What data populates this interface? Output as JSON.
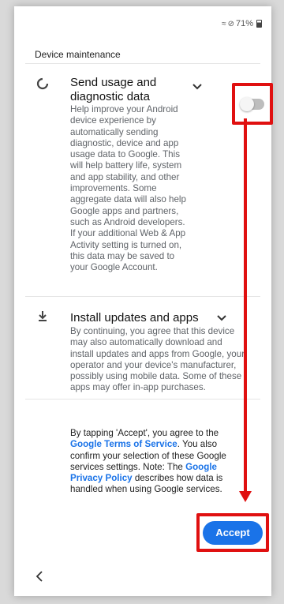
{
  "status_bar": {
    "battery": "71%"
  },
  "header": {
    "title": "Device maintenance"
  },
  "usage": {
    "title_line1": "Send usage and",
    "title_line2": "diagnostic data",
    "body": [
      "Help improve your Android",
      "device experience by",
      "automatically sending",
      "diagnostic, device and app",
      "usage data to Google. This",
      "will help battery life, system",
      "and app stability, and other",
      "improvements. Some",
      "aggregate data will also help",
      "Google apps and partners,",
      "such as Android developers.",
      "If your additional Web & App",
      "Activity setting is turned on,",
      "this data may be saved to",
      "your Google Account."
    ],
    "toggle_state": "off"
  },
  "updates": {
    "title": "Install updates and apps",
    "body": [
      "By continuing, you agree that this device",
      "may also automatically download and",
      "install updates and apps from Google, your",
      "operator and your device's manufacturer,",
      "possibly using mobile data. Some of these",
      "apps may offer in-app purchases."
    ]
  },
  "consent": {
    "line1": "By tapping 'Accept', you agree to the",
    "tos_link": "Google Terms of Service",
    "after_tos": ". You also",
    "line3": "confirm your selection of these Google",
    "line4": "services settings. Note: The ",
    "privacy_link_1": "Google",
    "privacy_link_2": "Privacy Policy",
    "line5_rest": " describes how data is",
    "line6": "handled when using Google services."
  },
  "footer": {
    "accept_label": "Accept"
  },
  "colors": {
    "accent": "#1a73e8",
    "annotation": "#e01010"
  },
  "icons": {
    "usage": "spinner-icon",
    "updates": "download-icon",
    "back": "back-chevron-icon"
  }
}
